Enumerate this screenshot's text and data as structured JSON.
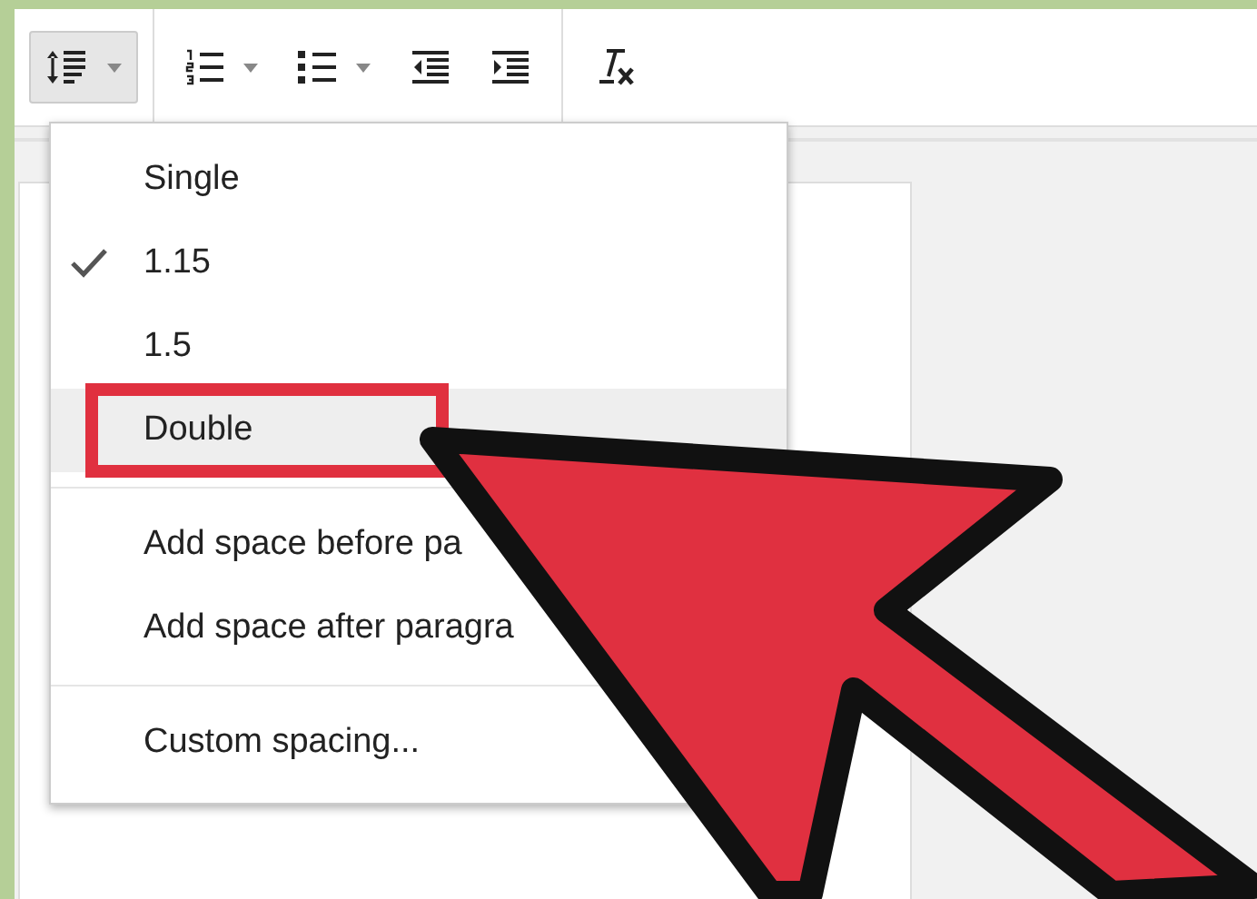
{
  "toolbar": {
    "groups": [
      {
        "buttons": [
          {
            "kind": "spacing",
            "dropdown": true,
            "pressed": true
          }
        ]
      },
      {
        "buttons": [
          {
            "kind": "numbered",
            "dropdown": true,
            "pressed": false
          },
          {
            "kind": "bulleted",
            "dropdown": true,
            "pressed": false
          },
          {
            "kind": "outdent",
            "dropdown": false,
            "pressed": false
          },
          {
            "kind": "indent",
            "dropdown": false,
            "pressed": false
          }
        ]
      },
      {
        "buttons": [
          {
            "kind": "clear",
            "dropdown": false,
            "pressed": false
          }
        ]
      }
    ]
  },
  "menu": {
    "groups": [
      [
        {
          "label": "Single",
          "checked": false,
          "hovered": false,
          "outlined": false
        },
        {
          "label": "1.15",
          "checked": true,
          "hovered": false,
          "outlined": false
        },
        {
          "label": "1.5",
          "checked": false,
          "hovered": false,
          "outlined": false
        },
        {
          "label": "Double",
          "checked": false,
          "hovered": true,
          "outlined": true
        }
      ],
      [
        {
          "label": "Add space before pa",
          "checked": false,
          "hovered": false,
          "outlined": false
        },
        {
          "label": "Add space after paragra",
          "checked": false,
          "hovered": false,
          "outlined": false
        }
      ],
      [
        {
          "label": "Custom spacing...",
          "checked": false,
          "hovered": false,
          "outlined": false
        }
      ]
    ]
  }
}
